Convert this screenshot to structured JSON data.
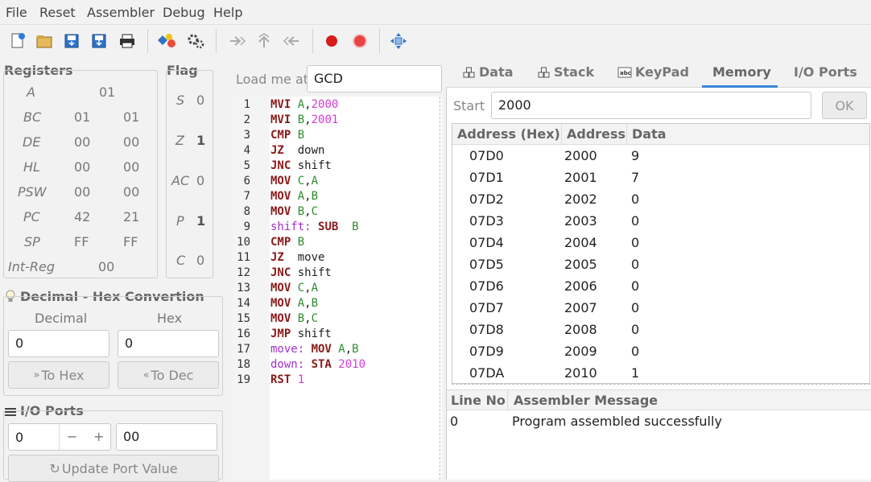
{
  "menu": [
    "File",
    "Reset",
    "Assembler",
    "Debug",
    "Help"
  ],
  "toolbar": {
    "icons": [
      "new-file-icon",
      "open-folder-icon",
      "save-icon",
      "save-as-icon",
      "print-icon",
      "assemble-icon",
      "settings-icon",
      "step-over-icon",
      "step-into-icon",
      "step-back-icon",
      "record-icon",
      "stop-icon",
      "move-icon"
    ]
  },
  "registers": {
    "title": "Registers",
    "rows": [
      {
        "name": "A",
        "v1": "01",
        "v2": ""
      },
      {
        "name": "BC",
        "v1": "01",
        "v2": "01"
      },
      {
        "name": "DE",
        "v1": "00",
        "v2": "00"
      },
      {
        "name": "HL",
        "v1": "00",
        "v2": "00"
      },
      {
        "name": "PSW",
        "v1": "00",
        "v2": "00"
      },
      {
        "name": "PC",
        "v1": "42",
        "v2": "21"
      },
      {
        "name": "SP",
        "v1": "FF",
        "v2": "FF"
      },
      {
        "name": "Int-Reg",
        "v1": "00",
        "v2": ""
      }
    ]
  },
  "flags": {
    "title": "Flag",
    "rows": [
      {
        "name": "S",
        "v": "0"
      },
      {
        "name": "Z",
        "v": "1"
      },
      {
        "name": "AC",
        "v": "0"
      },
      {
        "name": "P",
        "v": "1"
      },
      {
        "name": "C",
        "v": "0"
      }
    ]
  },
  "converter": {
    "title": "Decimal - Hex Convertion",
    "decimal_label": "Decimal",
    "hex_label": "Hex",
    "decimal_value": "0",
    "hex_value": "0",
    "to_hex": "To Hex",
    "to_dec": "To Dec"
  },
  "io": {
    "title": "I/O Ports",
    "port": "0",
    "minus": "−",
    "plus": "+",
    "value": "00",
    "update": "Update Port Value"
  },
  "load": {
    "label": "Load me at",
    "value": "GCD"
  },
  "code": [
    {
      "n": "1",
      "parts": [
        [
          "kw",
          "MVI "
        ],
        [
          "rg",
          "A"
        ],
        [
          "tx",
          ","
        ],
        [
          "nm",
          "2000"
        ]
      ]
    },
    {
      "n": "2",
      "parts": [
        [
          "kw",
          "MVI "
        ],
        [
          "rg",
          "B"
        ],
        [
          "tx",
          ","
        ],
        [
          "nm",
          "2001"
        ]
      ]
    },
    {
      "n": "3",
      "parts": [
        [
          "kw",
          "CMP "
        ],
        [
          "rg",
          "B"
        ]
      ]
    },
    {
      "n": "4",
      "parts": [
        [
          "kw",
          "JZ  "
        ],
        [
          "tx",
          "down"
        ]
      ]
    },
    {
      "n": "5",
      "parts": [
        [
          "kw",
          "JNC "
        ],
        [
          "tx",
          "shift"
        ]
      ]
    },
    {
      "n": "6",
      "parts": [
        [
          "kw",
          "MOV "
        ],
        [
          "rg",
          "C"
        ],
        [
          "tx",
          ","
        ],
        [
          "rg",
          "A"
        ]
      ]
    },
    {
      "n": "7",
      "parts": [
        [
          "kw",
          "MOV "
        ],
        [
          "rg",
          "A"
        ],
        [
          "tx",
          ","
        ],
        [
          "rg",
          "B"
        ]
      ]
    },
    {
      "n": "8",
      "parts": [
        [
          "kw",
          "MOV "
        ],
        [
          "rg",
          "B"
        ],
        [
          "tx",
          ","
        ],
        [
          "rg",
          "C"
        ]
      ]
    },
    {
      "n": "9",
      "parts": [
        [
          "lb",
          "shift: "
        ],
        [
          "kw",
          "SUB  "
        ],
        [
          "rg",
          "B"
        ]
      ]
    },
    {
      "n": "10",
      "parts": [
        [
          "kw",
          "CMP "
        ],
        [
          "rg",
          "B"
        ]
      ]
    },
    {
      "n": "11",
      "parts": [
        [
          "kw",
          "JZ  "
        ],
        [
          "tx",
          "move"
        ]
      ]
    },
    {
      "n": "12",
      "parts": [
        [
          "kw",
          "JNC "
        ],
        [
          "tx",
          "shift"
        ]
      ]
    },
    {
      "n": "13",
      "parts": [
        [
          "kw",
          "MOV "
        ],
        [
          "rg",
          "C"
        ],
        [
          "tx",
          ","
        ],
        [
          "rg",
          "A"
        ]
      ]
    },
    {
      "n": "14",
      "parts": [
        [
          "kw",
          "MOV "
        ],
        [
          "rg",
          "A"
        ],
        [
          "tx",
          ","
        ],
        [
          "rg",
          "B"
        ]
      ]
    },
    {
      "n": "15",
      "parts": [
        [
          "kw",
          "MOV "
        ],
        [
          "rg",
          "B"
        ],
        [
          "tx",
          ","
        ],
        [
          "rg",
          "C"
        ]
      ]
    },
    {
      "n": "16",
      "parts": [
        [
          "kw",
          "JMP "
        ],
        [
          "tx",
          "shift"
        ]
      ]
    },
    {
      "n": "17",
      "parts": [
        [
          "lb",
          "move: "
        ],
        [
          "kw",
          "MOV "
        ],
        [
          "rg",
          "A"
        ],
        [
          "tx",
          ","
        ],
        [
          "rg",
          "B"
        ]
      ]
    },
    {
      "n": "18",
      "parts": [
        [
          "lb",
          "down: "
        ],
        [
          "kw",
          "STA "
        ],
        [
          "nm",
          "2010"
        ]
      ]
    },
    {
      "n": "19",
      "parts": [
        [
          "kw",
          "RST "
        ],
        [
          "nm",
          "1"
        ]
      ]
    }
  ],
  "tabs": [
    {
      "label": "Data",
      "icon": "cubes-icon",
      "active": false
    },
    {
      "label": "Stack",
      "icon": "cubes-icon",
      "active": false
    },
    {
      "label": "KeyPad",
      "icon": "keypad-icon",
      "active": false
    },
    {
      "label": "Memory",
      "icon": "",
      "active": true
    },
    {
      "label": "I/O Ports",
      "icon": "",
      "active": false
    }
  ],
  "memory": {
    "start_label": "Start",
    "start_value": "2000",
    "ok": "OK",
    "headers": [
      "Address (Hex)",
      "Address",
      "Data"
    ],
    "rows": [
      [
        "07D0",
        "2000",
        "9"
      ],
      [
        "07D1",
        "2001",
        "7"
      ],
      [
        "07D2",
        "2002",
        "0"
      ],
      [
        "07D3",
        "2003",
        "0"
      ],
      [
        "07D4",
        "2004",
        "0"
      ],
      [
        "07D5",
        "2005",
        "0"
      ],
      [
        "07D6",
        "2006",
        "0"
      ],
      [
        "07D7",
        "2007",
        "0"
      ],
      [
        "07D8",
        "2008",
        "0"
      ],
      [
        "07D9",
        "2009",
        "0"
      ],
      [
        "07DA",
        "2010",
        "1"
      ]
    ]
  },
  "messages": {
    "headers": [
      "Line No",
      "Assembler Message"
    ],
    "rows": [
      [
        "0",
        "Program assembled successfully"
      ]
    ]
  }
}
